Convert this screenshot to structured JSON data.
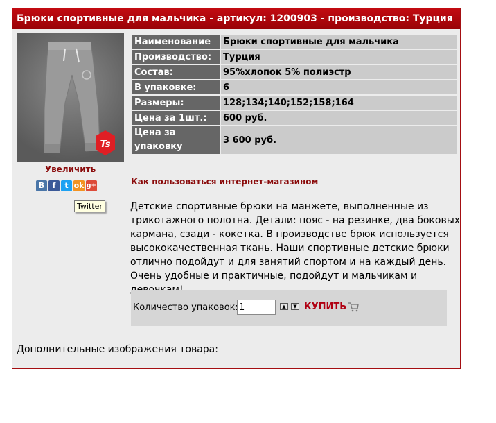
{
  "header": {
    "title": "Брюки спортивные для мальчика - артикул: 1200903 - производство: Турция"
  },
  "product": {
    "zoom_label": "Увеличить",
    "photo_badge_text": "Ts",
    "share_icons": [
      {
        "name": "vkontakte-icon",
        "glyph": "B",
        "color": "#4a76a8"
      },
      {
        "name": "facebook-icon",
        "glyph": "f",
        "color": "#3b5998"
      },
      {
        "name": "twitter-icon",
        "glyph": "t",
        "color": "#1da1f2"
      },
      {
        "name": "odnoklassniki-icon",
        "glyph": "ok",
        "color": "#f39322"
      },
      {
        "name": "google-plus-icon",
        "glyph": "g+",
        "color": "#dd4b39"
      }
    ],
    "tooltip": "Twitter"
  },
  "specs": [
    {
      "key": "Наименование",
      "value": "Брюки спортивные для мальчика"
    },
    {
      "key": "Производство:",
      "value": "Турция"
    },
    {
      "key": "Состав:",
      "value": "95%хлопок 5% полиэстр"
    },
    {
      "key": "В упаковке:",
      "value": "6"
    },
    {
      "key": "Размеры:",
      "value": "128;134;140;152;158;164"
    },
    {
      "key": "Цена за 1шт.:",
      "value": "600 руб."
    },
    {
      "key": "Цена за упаковку",
      "value": "3 600 руб."
    }
  ],
  "howto_link": "Как пользоваться интернет-магазином",
  "description": "Детские спортивные брюки на манжете, выполненные из трикотажного полотна.  Детали: пояс - на резинке, два боковых кармана, сзади - кокетка. В производстве брюк используется высококачественная ткань. Наши спортивные детские брюки  отлично подойдут и для занятий спортом и на каждый день. Очень удобные и практичные, подойдут и мальчикам и девочкам!",
  "order": {
    "qty_label": "Количество упаковок:",
    "qty_value": "1",
    "buy_label": "КУПИТЬ"
  },
  "extra_images_label": "Дополнительные изображения товара:",
  "colors": {
    "accent": "#b2050b",
    "key_cell": "#666666",
    "value_cell": "#cbcbcb",
    "panel_bg": "#ececec"
  }
}
